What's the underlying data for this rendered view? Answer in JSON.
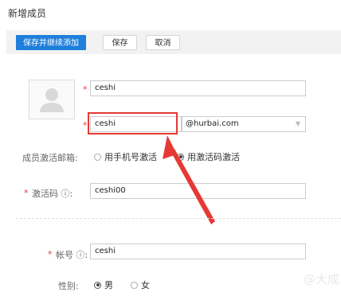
{
  "page": {
    "title": "新增成员"
  },
  "toolbar": {
    "save_continue_label": "保存并继续添加",
    "save_label": "保存",
    "cancel_label": "取消"
  },
  "form": {
    "name_value": "ceshi",
    "email_prefix_value": "ceshi",
    "email_domain": "@hurbai.com",
    "activation_label": "成员激活邮箱:",
    "activation_options": [
      "用手机号激活",
      "用激活码激活"
    ],
    "activation_code_label": "激活码 ⓘ:",
    "activation_code_value": "ceshi00",
    "account_label": "帐号 ⓘ:",
    "account_value": "ceshi",
    "gender_label": "性别:",
    "gender_options": [
      "男",
      "女"
    ],
    "required_mark": "*"
  },
  "watermark": "@大成"
}
